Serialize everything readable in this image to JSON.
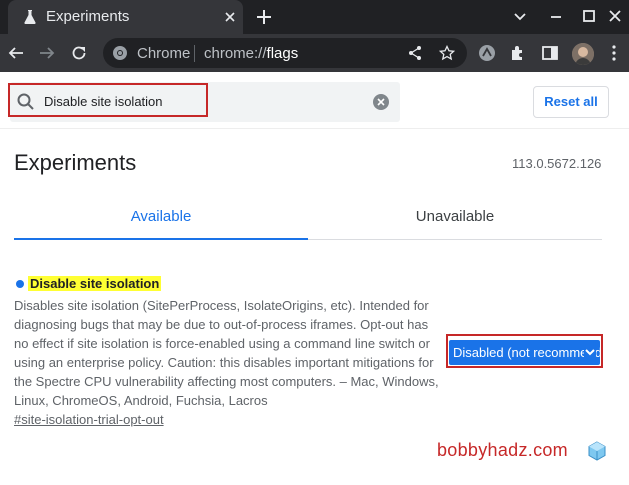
{
  "browser": {
    "tab_title": "Experiments",
    "omnibox_site": "Chrome",
    "omnibox_url_scheme": "chrome://",
    "omnibox_url_host": "flags"
  },
  "search": {
    "value": "Disable site isolation",
    "reset_label": "Reset all"
  },
  "page": {
    "title": "Experiments",
    "version": "113.0.5672.126",
    "tabs": [
      {
        "label": "Available",
        "active": true
      },
      {
        "label": "Unavailable",
        "active": false
      }
    ]
  },
  "flag": {
    "name": "Disable site isolation",
    "description": "Disables site isolation (SitePerProcess, IsolateOrigins, etc). Intended for diagnosing bugs that may be due to out-of-process iframes. Opt-out has no effect if site isolation is force-enabled using a command line switch or using an enterprise policy. Caution: this disables important mitigations for the Spectre CPU vulnerability affecting most computers. – Mac, Windows, Linux, ChromeOS, Android, Fuchsia, Lacros",
    "link": "#site-isolation-trial-opt-out",
    "selected_option": "Disabled (not recommended)"
  },
  "watermark": "bobbyhadz.com",
  "colors": {
    "accent": "#1a73e8",
    "highlight": "#ffff33",
    "annotation_red": "#c62828"
  }
}
